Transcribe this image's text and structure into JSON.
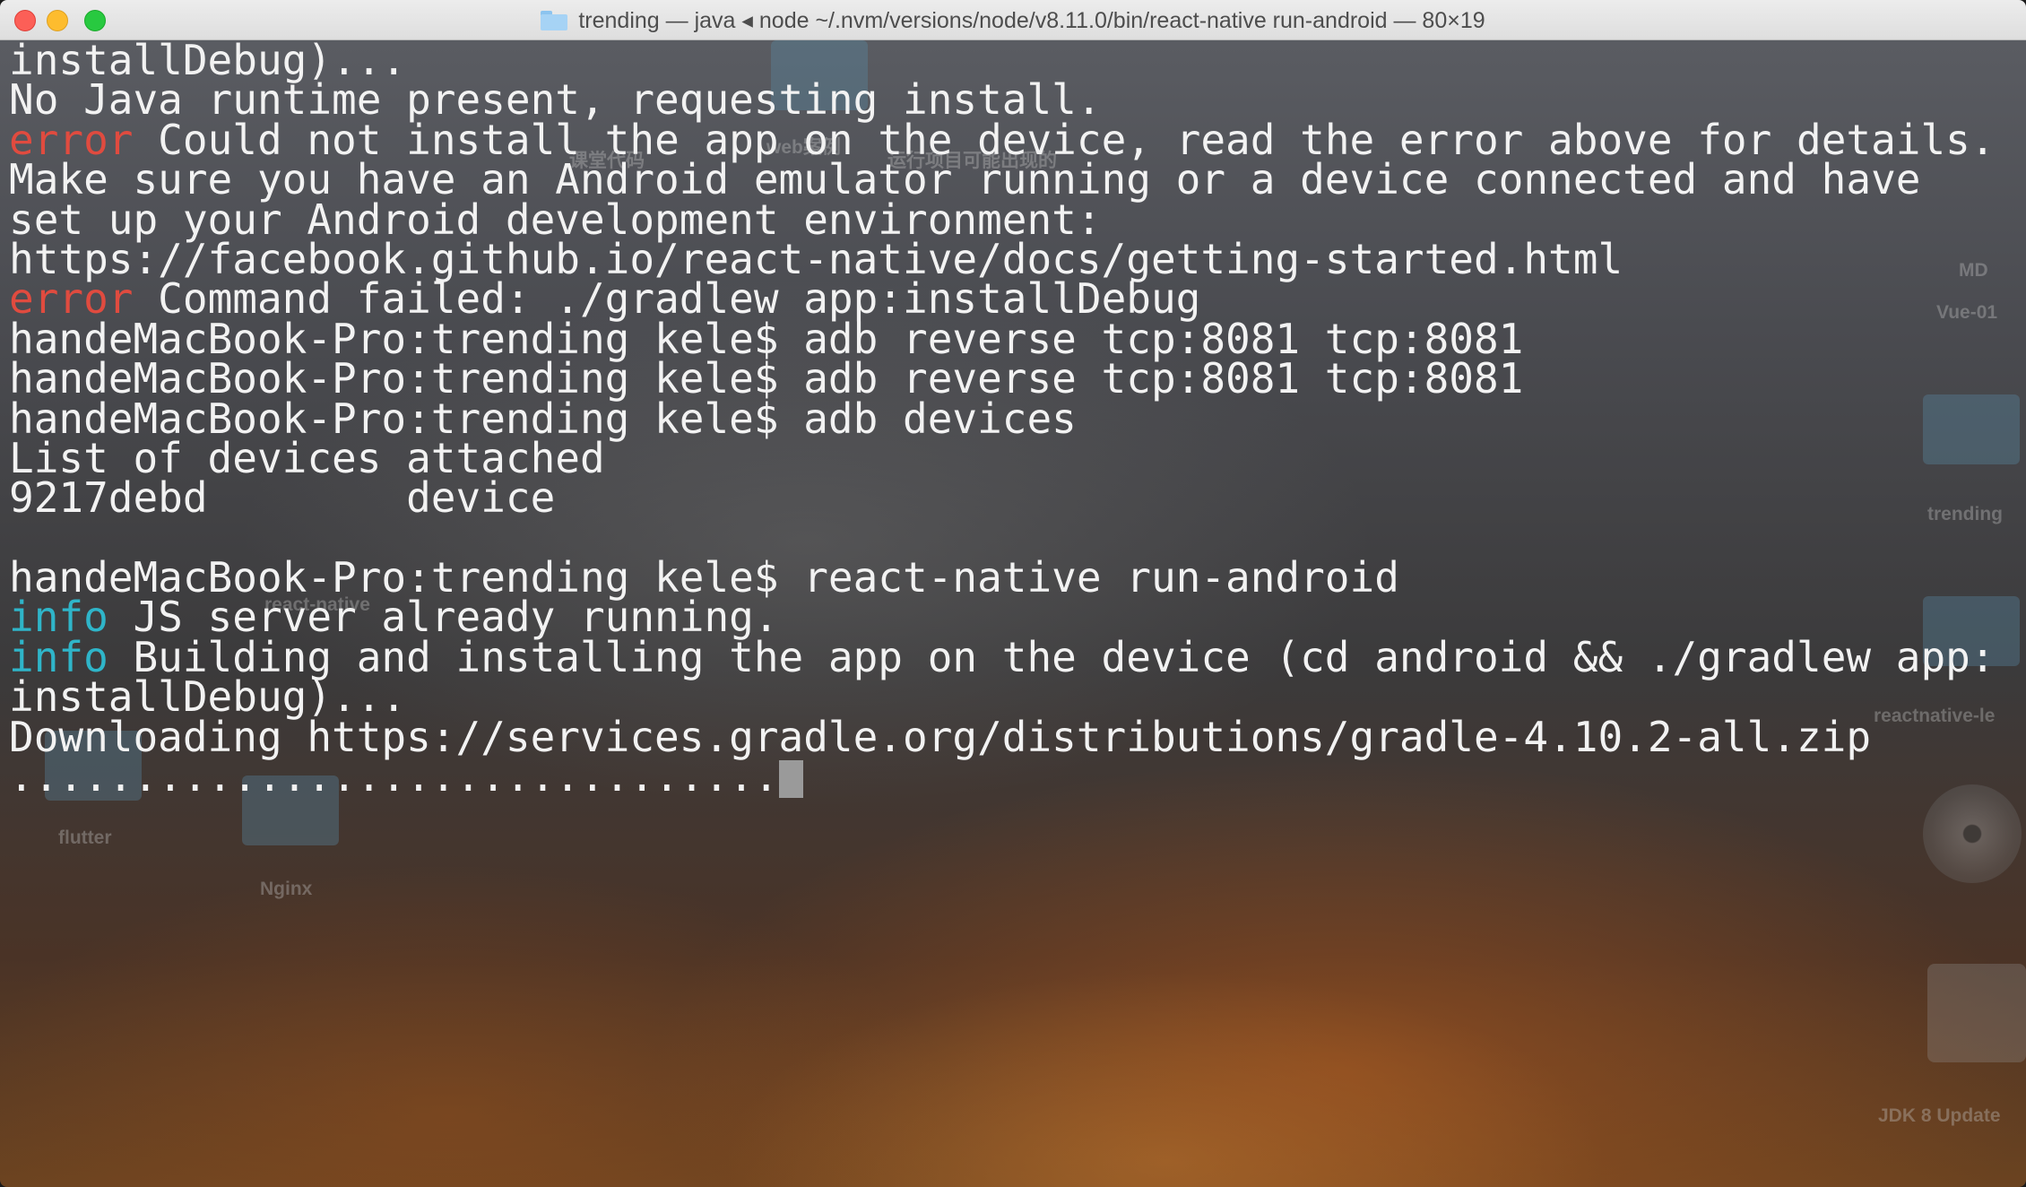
{
  "window": {
    "title": "trending — java ◂ node ~/.nvm/versions/node/v8.11.0/bin/react-native run-android — 80×19"
  },
  "terminal": {
    "lines": [
      {
        "parts": [
          {
            "text": "installDebug)..."
          }
        ]
      },
      {
        "parts": [
          {
            "text": "No Java runtime present, requesting install."
          }
        ]
      },
      {
        "parts": [
          {
            "text": "error",
            "style": "red"
          },
          {
            "text": " Could not install the app on the device, read the error above for details."
          }
        ]
      },
      {
        "parts": [
          {
            "text": "Make sure you have an Android emulator running or a device connected and have"
          }
        ]
      },
      {
        "parts": [
          {
            "text": "set up your Android development environment:"
          }
        ]
      },
      {
        "parts": [
          {
            "text": "https://facebook.github.io/react-native/docs/getting-started.html"
          }
        ]
      },
      {
        "parts": [
          {
            "text": "error",
            "style": "red"
          },
          {
            "text": " Command failed: ./gradlew app:installDebug"
          }
        ]
      },
      {
        "parts": [
          {
            "text": "handeMacBook-Pro:trending kele$ adb reverse tcp:8081 tcp:8081"
          }
        ]
      },
      {
        "parts": [
          {
            "text": "handeMacBook-Pro:trending kele$ adb reverse tcp:8081 tcp:8081"
          }
        ]
      },
      {
        "parts": [
          {
            "text": "handeMacBook-Pro:trending kele$ adb devices"
          }
        ]
      },
      {
        "parts": [
          {
            "text": "List of devices attached"
          }
        ]
      },
      {
        "parts": [
          {
            "text": "9217debd\tdevice"
          }
        ]
      },
      {
        "parts": [
          {
            "text": ""
          }
        ]
      },
      {
        "parts": [
          {
            "text": "handeMacBook-Pro:trending kele$ react-native run-android"
          }
        ]
      },
      {
        "parts": [
          {
            "text": "info",
            "style": "cyan"
          },
          {
            "text": " JS server already running."
          }
        ]
      },
      {
        "parts": [
          {
            "text": "info",
            "style": "cyan"
          },
          {
            "text": " Building and installing the app on the device (cd android && ./gradlew app:"
          }
        ]
      },
      {
        "parts": [
          {
            "text": "installDebug)..."
          }
        ]
      },
      {
        "parts": [
          {
            "text": "Downloading https://services.gradle.org/distributions/gradle-4.10.2-all.zip"
          }
        ]
      },
      {
        "parts": [
          {
            "text": "..............................."
          }
        ],
        "cursor": true
      }
    ]
  },
  "desktop": {
    "labels": [
      "Vue-01",
      "trending",
      "reactnative-le",
      "JDK 8 Update",
      "flutter",
      "Nginx",
      "react-native",
      "web案例",
      "课堂代码",
      "运行项目可能出现的",
      "MD"
    ]
  }
}
